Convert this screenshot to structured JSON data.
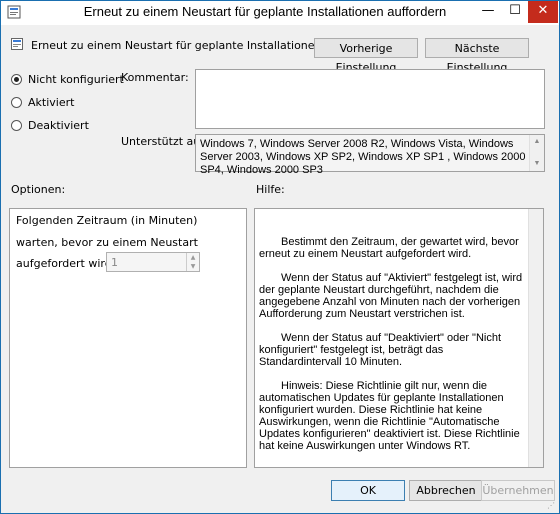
{
  "window": {
    "title": "Erneut zu einem Neustart für geplante Installationen auffordern",
    "minimize_glyph": "—",
    "maximize_glyph": "☐",
    "close_glyph": "✕"
  },
  "header": {
    "policy_name": "Erneut zu einem Neustart für geplante Installationen auffordern",
    "prev_button": "Vorherige Einstellung",
    "next_button": "Nächste Einstellung"
  },
  "state": {
    "options": [
      {
        "label": "Nicht konfiguriert",
        "selected": true
      },
      {
        "label": "Aktiviert",
        "selected": false
      },
      {
        "label": "Deaktiviert",
        "selected": false
      }
    ]
  },
  "comment": {
    "label": "Kommentar:",
    "value": ""
  },
  "supported": {
    "label": "Unterstützt auf:",
    "value": "Windows 7, Windows Server 2008 R2, Windows Vista, Windows Server 2003, Windows XP SP2, Windows XP SP1 , Windows 2000 SP4, Windows 2000 SP3"
  },
  "options_section": {
    "title": "Optionen:",
    "line1": "Folgenden Zeitraum (in Minuten)",
    "line2": "warten, bevor zu einem Neustart",
    "line3": "aufgefordert wird:",
    "spinner_value": "1"
  },
  "help_section": {
    "title": "Hilfe:",
    "paragraphs": [
      "Bestimmt den Zeitraum, der gewartet wird, bevor erneut zu einem Neustart aufgefordert wird.",
      "Wenn der Status auf \"Aktiviert\" festgelegt ist, wird der geplante Neustart durchgeführt, nachdem die angegebene Anzahl von Minuten nach der vorherigen Aufforderung zum Neustart verstrichen ist.",
      "Wenn der Status auf \"Deaktiviert\" oder \"Nicht konfiguriert\" festgelegt ist, beträgt das Standardintervall 10 Minuten.",
      "Hinweis: Diese Richtlinie gilt nur, wenn die automatischen Updates für geplante Installationen konfiguriert wurden. Diese Richtlinie hat keine Auswirkungen, wenn die Richtlinie \"Automatische Updates konfigurieren\" deaktiviert ist. Diese Richtlinie hat keine Auswirkungen unter Windows RT."
    ]
  },
  "footer": {
    "ok": "OK",
    "cancel": "Abbrechen",
    "apply": "Übernehmen"
  }
}
